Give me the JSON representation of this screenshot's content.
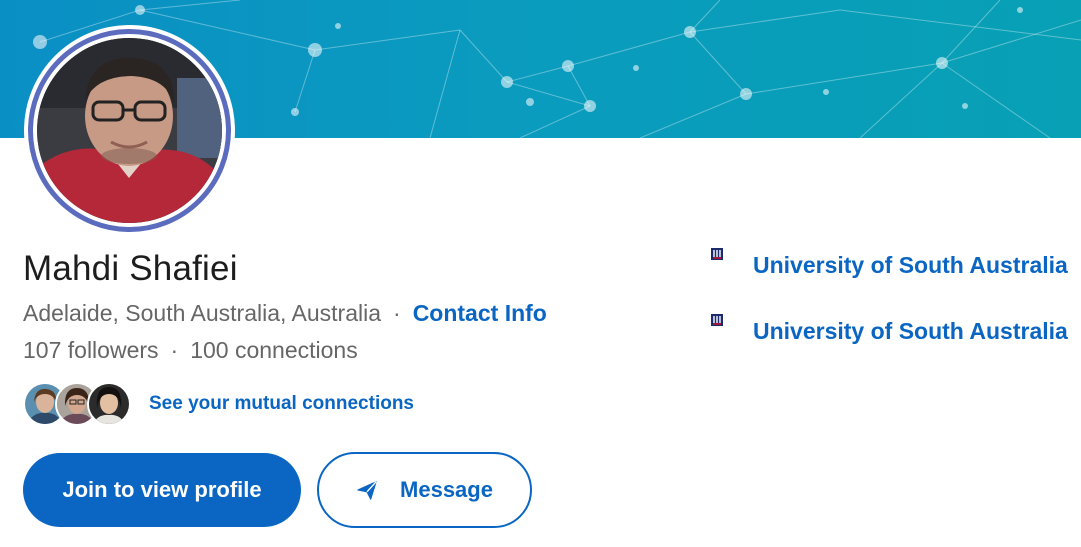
{
  "profile": {
    "name": "Mahdi Shafiei",
    "location": "Adelaide, South Australia, Australia",
    "separator": "·",
    "contact_info": "Contact Info",
    "followers": "107 followers",
    "connections": "100 connections",
    "mutual_link": "See your mutual connections"
  },
  "actions": {
    "join": "Join to view profile",
    "message": "Message"
  },
  "education": [
    {
      "name": "University of South Australia",
      "logo_text": "University of South Australia",
      "logo_icon": "university-logo-icon"
    },
    {
      "name": "University of South Australia",
      "logo_text": "University of South Australia",
      "logo_icon": "university-logo-icon"
    }
  ],
  "colors": {
    "accent": "#0a66c2",
    "banner": "#0a9bbf",
    "avatar_ring": "#5b6bbd",
    "text_primary": "#1d1d1d",
    "text_secondary": "#666666"
  },
  "icons": {
    "send": "send-icon",
    "mutual_avatars": [
      "mutual-avatar-1",
      "mutual-avatar-2",
      "mutual-avatar-3"
    ]
  }
}
